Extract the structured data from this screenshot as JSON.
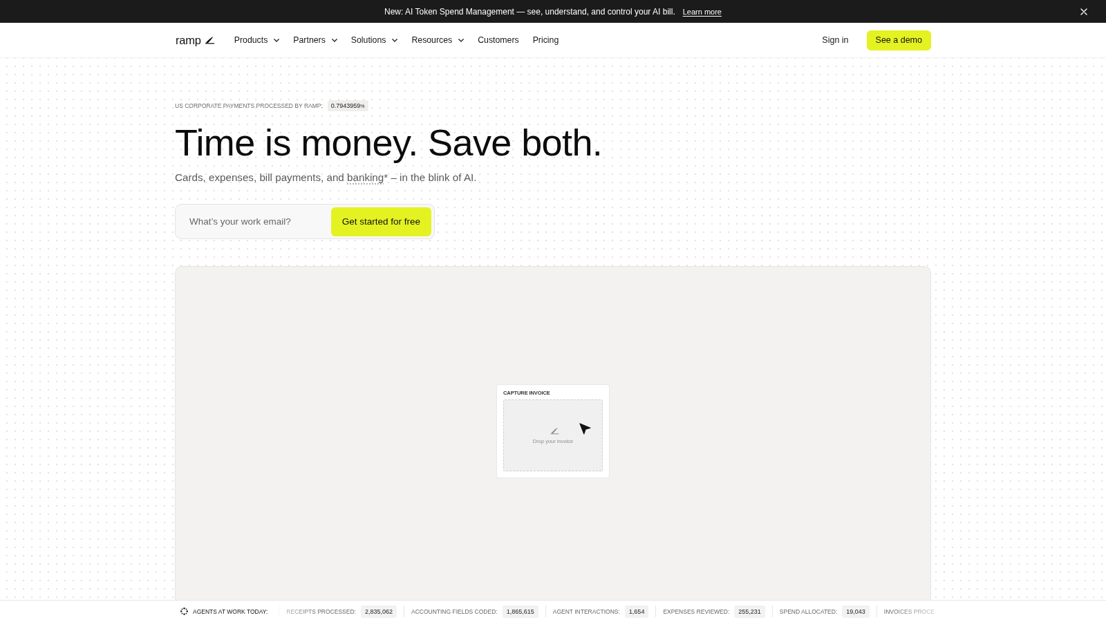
{
  "announcement": {
    "text": "New: AI Token Spend Management — see, understand, and control your AI bill.",
    "link": "Learn more"
  },
  "nav": {
    "logo": "ramp",
    "items": [
      {
        "label": "Products",
        "kind": "dropdown"
      },
      {
        "label": "Partners",
        "kind": "dropdown"
      },
      {
        "label": "Solutions",
        "kind": "dropdown"
      },
      {
        "label": "Resources",
        "kind": "dropdown"
      },
      {
        "label": "Customers",
        "kind": "link"
      },
      {
        "label": "Pricing",
        "kind": "link"
      }
    ],
    "sign_in": "Sign in",
    "demo_button": "See a demo"
  },
  "hero": {
    "counter_label": "US CORPORATE PAYMENTS PROCESSED BY RAMP:",
    "counter_value": "0.7943959",
    "counter_unit": "%",
    "headline": "Time is money. Save both.",
    "subtitle": {
      "before": "Cards, expenses, bill payments, and ",
      "term": "banking",
      "after": "* – in the blink of AI."
    },
    "email": {
      "placeholder": "What’s your work email?"
    },
    "cta": "Get started for free"
  },
  "demo": {
    "card_title": "CAPTURE INVOICE",
    "drop_text": "Drop your invoice"
  },
  "agents_bar": {
    "title": "AGENTS AT WORK TODAY:",
    "stats": [
      {
        "label": "RECEIPTS PROCESSED:",
        "value": "2,835,062"
      },
      {
        "label": "ACCOUNTING FIELDS CODED:",
        "value": "1,865,615"
      },
      {
        "label": "AGENT INTERACTIONS:",
        "value": "1,654"
      },
      {
        "label": "EXPENSES REVIEWED:",
        "value": "255,231"
      },
      {
        "label": "SPEND ALLOCATED:",
        "value": "19,043"
      },
      {
        "label": "INVOICES PROCE"
      }
    ]
  }
}
